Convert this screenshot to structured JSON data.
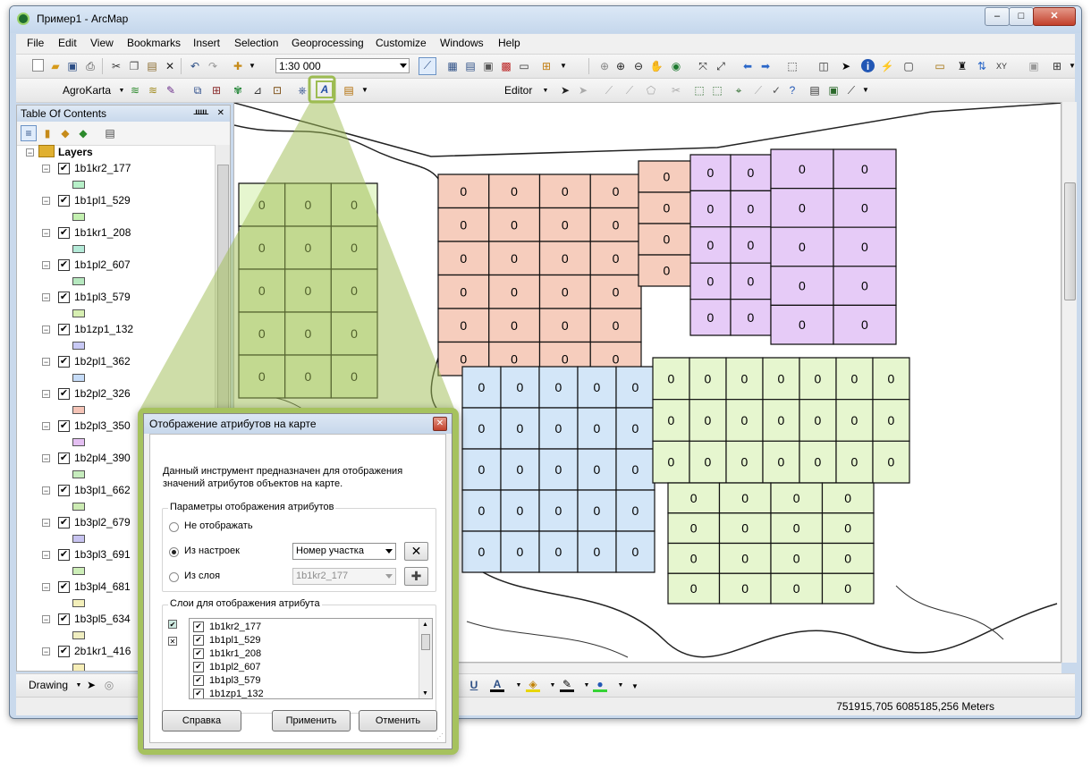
{
  "window": {
    "title": "Пример1 - ArcMap",
    "min": "–",
    "max": "□",
    "close": "✕"
  },
  "menu": [
    "File",
    "Edit",
    "View",
    "Bookmarks",
    "Insert",
    "Selection",
    "Geoprocessing",
    "Customize",
    "Windows",
    "Help"
  ],
  "toolbar": {
    "scale": "1:30 000",
    "agrokarta": "AgroKarta",
    "editor": "Editor"
  },
  "toc": {
    "title": "Table Of Contents",
    "pin": "ᚊ",
    "close": "✕",
    "root": "Layers",
    "layers": [
      {
        "name": "1b1kr2_177",
        "color": "#b7f0c8"
      },
      {
        "name": "1b1pl1_529",
        "color": "#c3f0b0"
      },
      {
        "name": "1b1kr1_208",
        "color": "#b4ead8"
      },
      {
        "name": "1b1pl2_607",
        "color": "#b6e8bf"
      },
      {
        "name": "1b1pl3_579",
        "color": "#d7efb2"
      },
      {
        "name": "1b1zp1_132",
        "color": "#c8c9f5"
      },
      {
        "name": "1b2pl1_362",
        "color": "#c6dcf8"
      },
      {
        "name": "1b2pl2_326",
        "color": "#f5c4b7"
      },
      {
        "name": "1b2pl3_350",
        "color": "#e4bff2"
      },
      {
        "name": "1b2pl4_390",
        "color": "#c6ecbd"
      },
      {
        "name": "1b3pl1_662",
        "color": "#ccebb3"
      },
      {
        "name": "1b3pl2_679",
        "color": "#c7c3f0"
      },
      {
        "name": "1b3pl3_691",
        "color": "#cdeeb8"
      },
      {
        "name": "1b3pl4_681",
        "color": "#f3efba"
      },
      {
        "name": "1b3pl5_634",
        "color": "#f0eec0"
      },
      {
        "name": "2b1kr1_416",
        "color": "#f6eeb7"
      }
    ]
  },
  "map": {
    "parcel_label": "0",
    "colors": {
      "salmon": "#f6cdbd",
      "violet": "#e6cbf7",
      "blue": "#d3e6f8",
      "green": "#e6f6cf",
      "callout": "#9dbc52"
    }
  },
  "drawing": {
    "label": "Drawing",
    "u": "U",
    "a": "A"
  },
  "status": {
    "coords": "751915,705  6085185,256 Meters"
  },
  "dialog": {
    "title": "Отображение атрибутов на карте",
    "description": "Данный инструмент предназначен для отображения значений атрибутов объектов на карте.",
    "params_group": "Параметры отображения атрибутов",
    "opt_none": "Не отображать",
    "opt_settings": "Из настроек",
    "opt_layer": "Из слоя",
    "settings_value": "Номер участка",
    "layer_value": "1b1kr2_177",
    "clear_btn": "✕",
    "add_btn": "✚",
    "layers_group": "Слои для отображения атрибута",
    "list": [
      "1b1kr2_177",
      "1b1pl1_529",
      "1b1kr1_208",
      "1b1pl2_607",
      "1b1pl3_579",
      "1b1zp1_132"
    ],
    "help": "Справка",
    "apply": "Применить",
    "cancel": "Отменить"
  }
}
